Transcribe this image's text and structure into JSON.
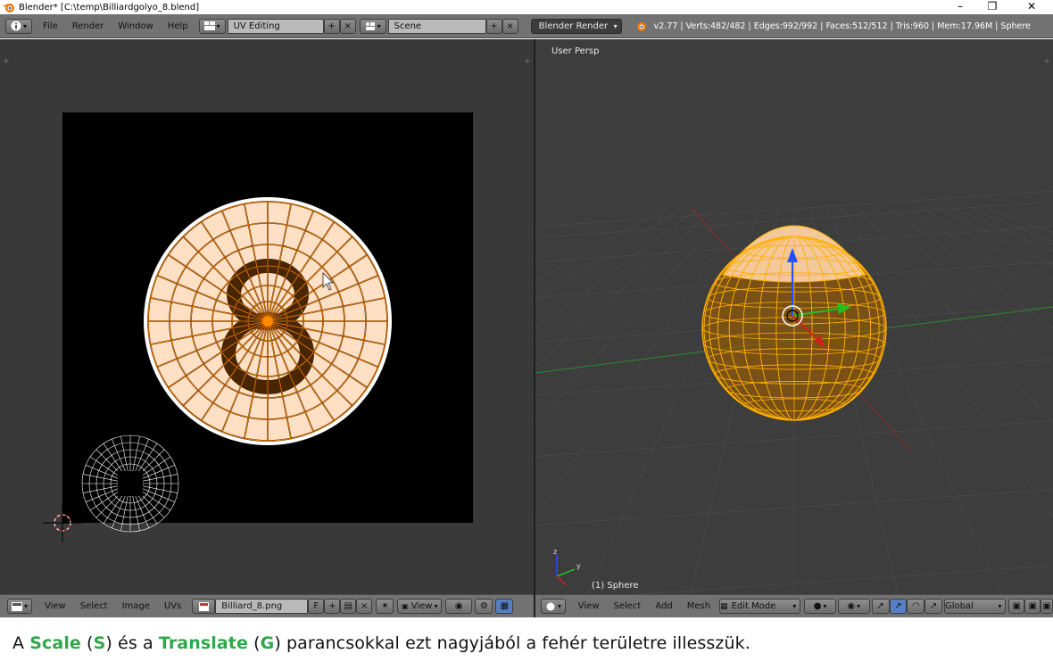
{
  "window": {
    "title": "Blender* [C:\\temp\\Billiardgolyo_8.blend]",
    "minimize_glyph": "–",
    "restore_glyph": "❐",
    "close_glyph": "✕"
  },
  "info_header": {
    "menus": [
      "File",
      "Render",
      "Window",
      "Help"
    ],
    "screen_layout": "UV Editing",
    "scene": "Scene",
    "render_engine": "Blender Render",
    "stats": "v2.77 | Verts:482/482 | Edges:992/992 | Faces:512/512 | Tris:960 | Mem:17.96M | Sphere"
  },
  "uv_editor": {
    "menus": [
      "View",
      "Select",
      "Image",
      "UVs"
    ],
    "image_name": "Billiard_8.png",
    "fake_user_label": "F",
    "view_label": "View"
  },
  "viewport": {
    "view_name": "User Persp",
    "object_label": "(1) Sphere",
    "menus": [
      "View",
      "Select",
      "Add",
      "Mesh"
    ],
    "mode": "Edit Mode",
    "orientation": "Global",
    "axis_labels": {
      "z": "z",
      "y": "y",
      "x": "x"
    }
  },
  "caption": {
    "part1": "A ",
    "scale_word": "Scale",
    "part2": " (",
    "scale_key": "S",
    "part3": ") és a ",
    "translate_word": "Translate",
    "part4": " (",
    "translate_key": "G",
    "part5": ") parancsokkal ezt nagyjából a fehér területre illesszük."
  },
  "colors": {
    "uv_selected": "#ff8a00",
    "uv_face_fill": "#ffe0c4",
    "mesh_wire": "#ffb000",
    "axis_x": "#d02020",
    "axis_y": "#20c020",
    "axis_z": "#2050ff"
  },
  "icons": [
    "blender-logo-icon",
    "info-editor-icon",
    "screen-layout-icon",
    "scene-icon",
    "image-editor-icon",
    "viewport-editor-icon",
    "cursor-icon"
  ]
}
